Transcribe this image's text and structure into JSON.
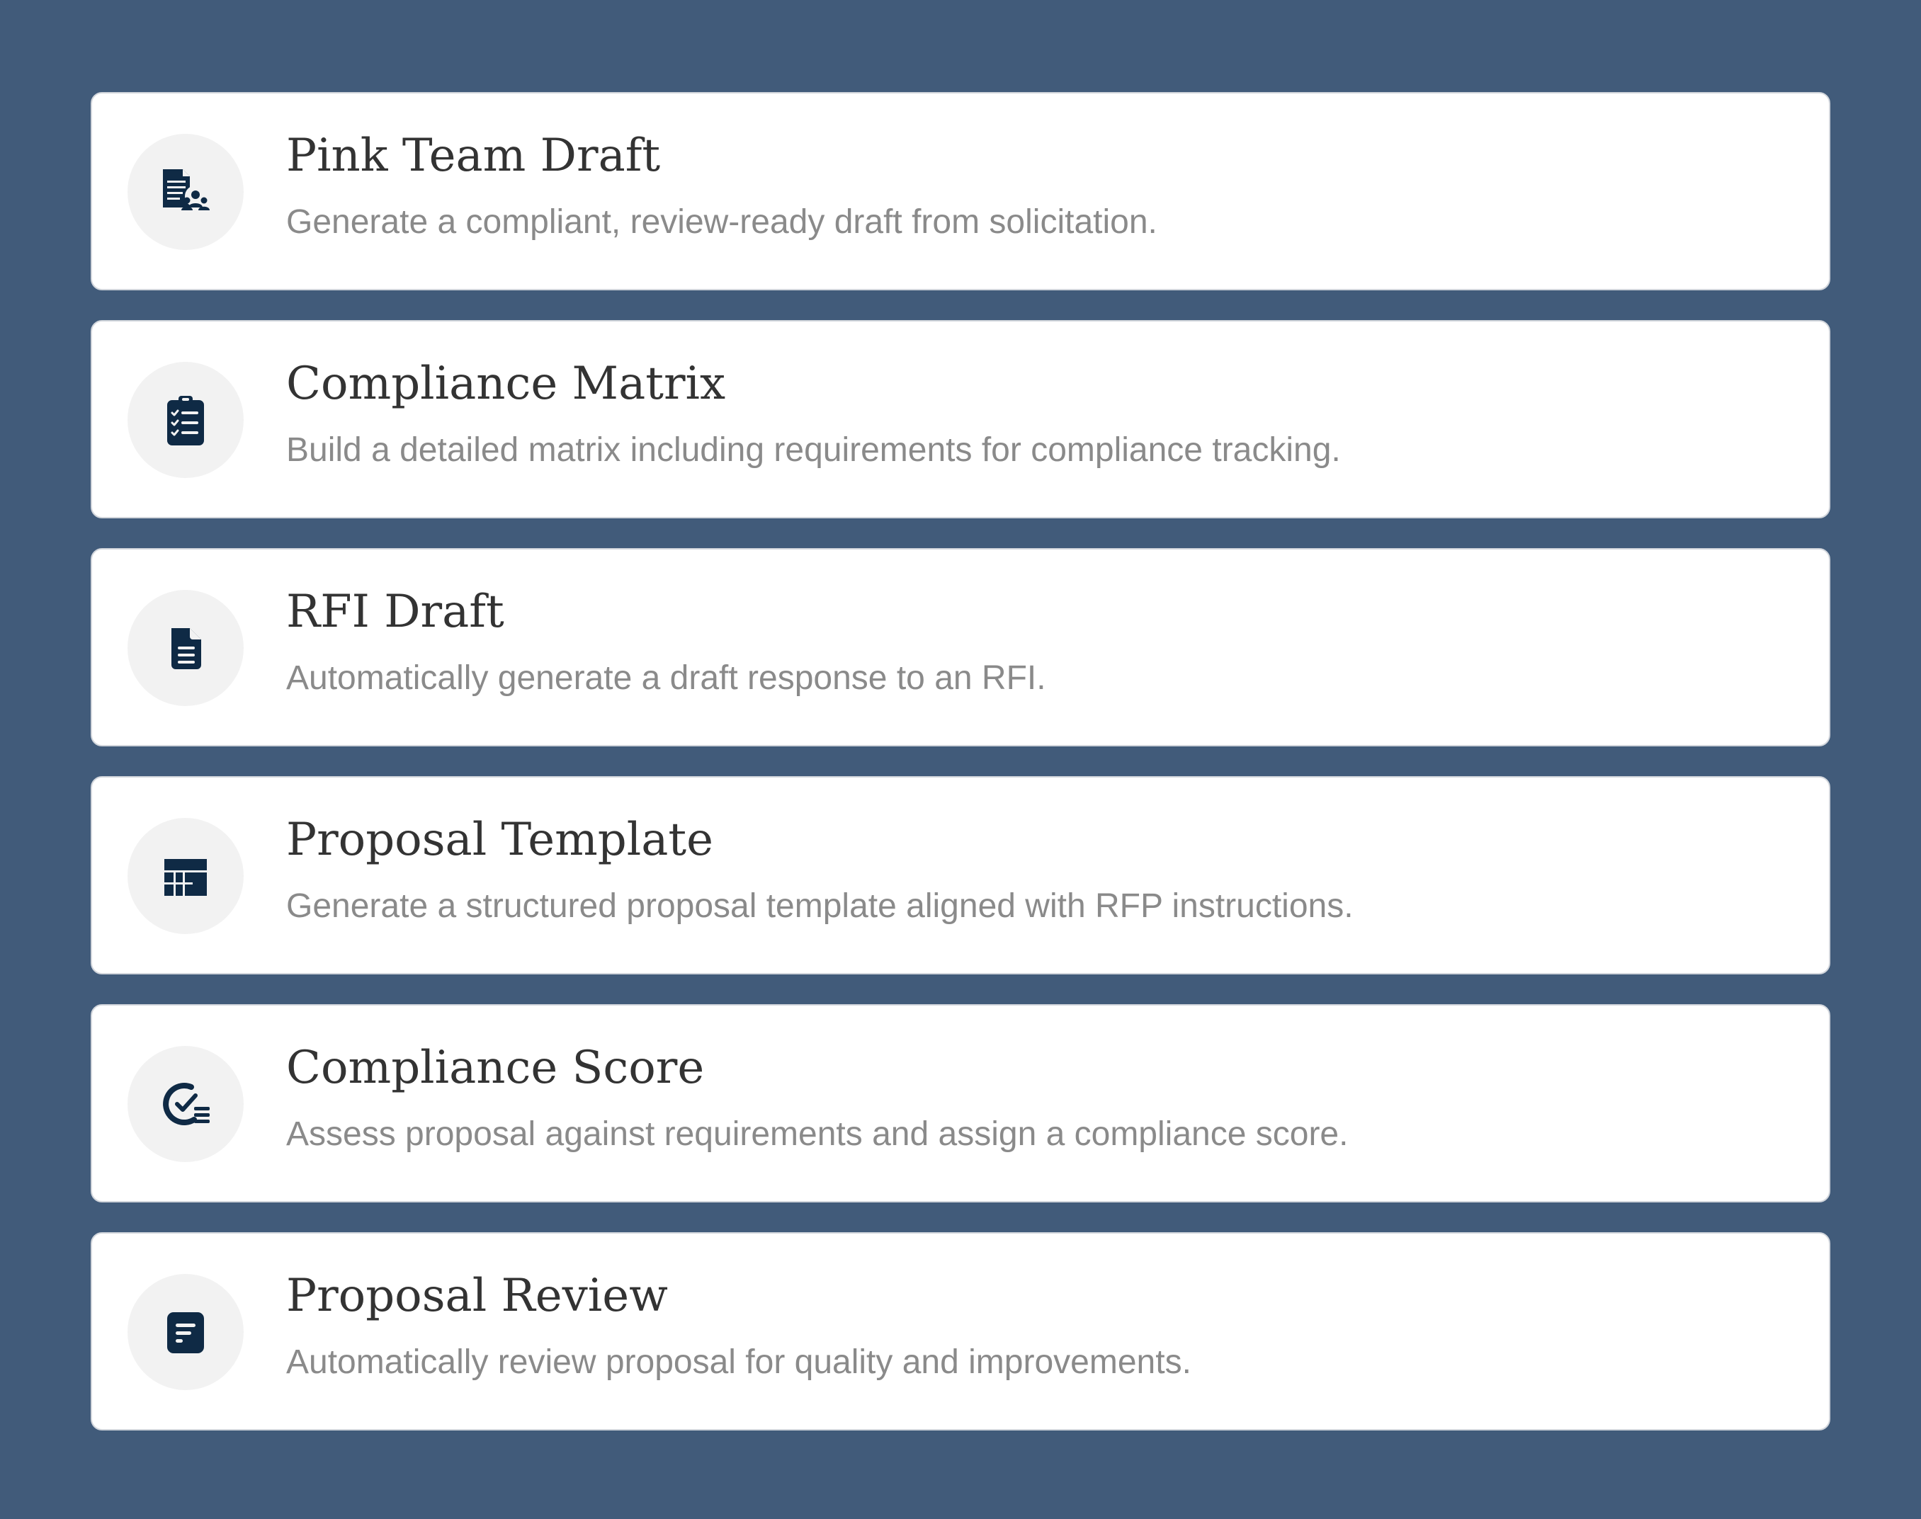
{
  "colors": {
    "background": "#415b7a",
    "card": "#ffffff",
    "icon_circle": "#f2f2f2",
    "icon": "#0f2a45",
    "title_text": "#333333",
    "description_text": "#8a8a8a"
  },
  "cards": [
    {
      "icon": "document-team-icon",
      "title": "Pink Team Draft",
      "description": "Generate a compliant, review-ready draft from solicitation."
    },
    {
      "icon": "clipboard-checklist-icon",
      "title": "Compliance Matrix",
      "description": "Build a detailed matrix including requirements for compliance tracking."
    },
    {
      "icon": "file-text-icon",
      "title": "RFI Draft",
      "description": "Automatically generate a draft response to an RFI."
    },
    {
      "icon": "table-layout-icon",
      "title": "Proposal Template",
      "description": "Generate a structured proposal template aligned with RFP instructions."
    },
    {
      "icon": "gauge-check-list-icon",
      "title": "Compliance Score",
      "description": "Assess proposal against requirements and assign a compliance score."
    },
    {
      "icon": "note-lines-icon",
      "title": "Proposal Review",
      "description": "Automatically review proposal for quality and improvements."
    }
  ]
}
